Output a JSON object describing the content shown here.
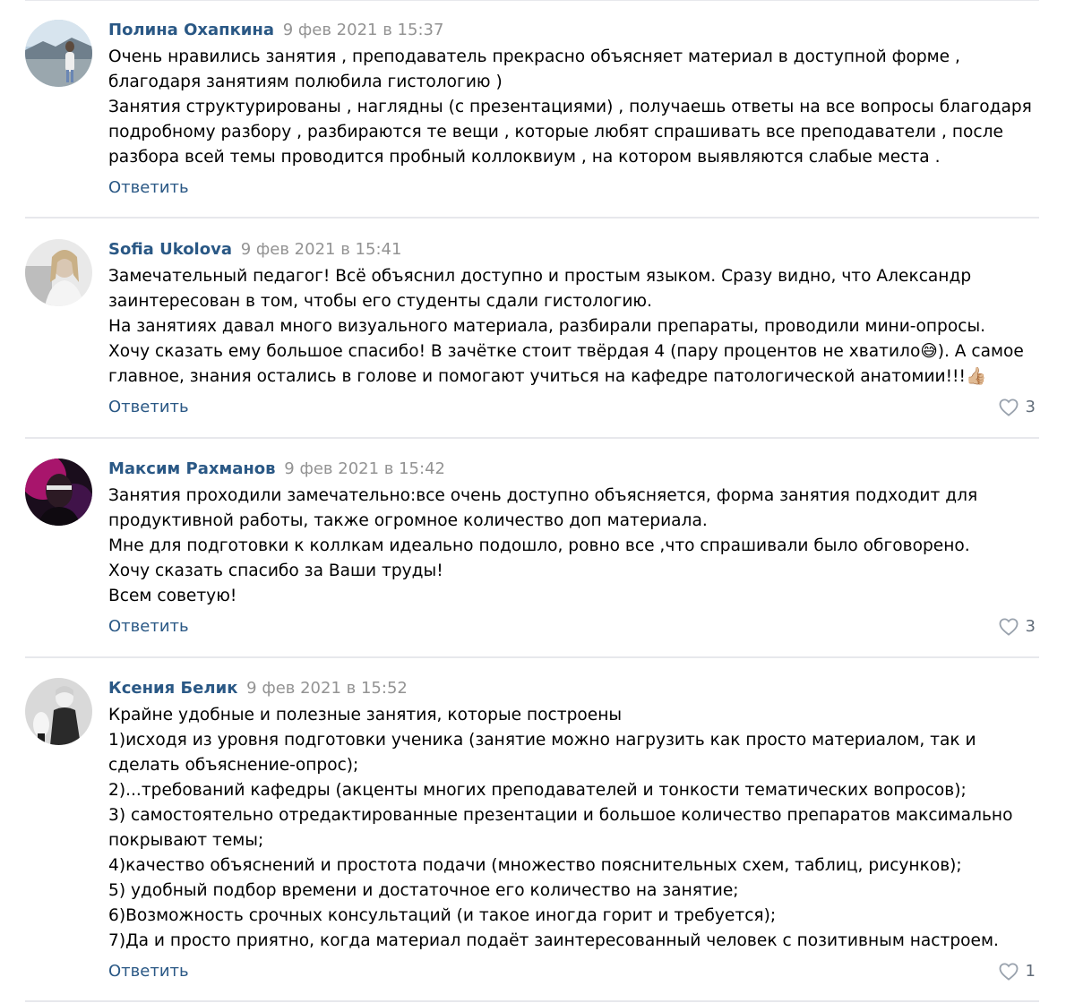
{
  "reply_label": "Ответить",
  "comments": [
    {
      "author": "Полина Охапкина",
      "date": "9 фев 2021 в 15:37",
      "lines": [
        "Очень нравились занятия , преподаватель прекрасно объясняет материал в доступной форме ,",
        "благодаря занятиям полюбила гистологию )",
        "Занятия структурированы , наглядны (с презентациями) , получаешь ответы на все вопросы благодаря",
        "подробному разбору , разбираются те вещи , которые любят спрашивать все преподаватели , после",
        "разбора всей темы проводится пробный коллоквиум , на котором выявляются слабые места ."
      ],
      "likes": null
    },
    {
      "author": "Sofia Ukolova",
      "date": "9 фев 2021 в 15:41",
      "lines": [
        "Замечательный педагог! Всё объяснил доступно и простым языком. Сразу видно, что Александр",
        "заинтересован в том, чтобы его студенты сдали гистологию.",
        "На занятиях давал много визуального материала, разбирали препараты, проводили мини-опросы.",
        "Хочу сказать ему большое спасибо! В зачётке стоит твёрдая 4 (пару процентов не хватило😅). А самое",
        "главное, знания остались в голове и помогают учиться на кафедре патологической анатомии!!!👍🏼"
      ],
      "likes": "3"
    },
    {
      "author": "Максим Рахманов",
      "date": "9 фев 2021 в 15:42",
      "lines": [
        "Занятия проходили замечательно:все очень доступно объясняется, форма занятия подходит для",
        "продуктивной работы, также огромное количество доп материала.",
        "Мне для подготовки к коллкам идеально подошло, ровно все ,что спрашивали было обговорено.",
        "Хочу сказать спасибо за Ваши труды!",
        "Всем советую!"
      ],
      "likes": "3"
    },
    {
      "author": "Ксения Белик",
      "date": "9 фев 2021 в 15:52",
      "lines": [
        "Крайне удобные и полезные занятия, которые построены",
        "1)исходя из уровня подготовки ученика (занятие можно нагрузить как просто материалом, так и",
        "сделать объяснение-опрос);",
        "2)...требований кафедры (акценты многих преподавателей и тонкости тематических вопросов);",
        "3) самостоятельно отредактированные презентации и большое количество препаратов максимально",
        "покрывают темы;",
        "4)качество объяснений и простота подачи (множество пояснительных схем, таблиц, рисунков);",
        "5) удобный подбор времени и достаточное его количество на занятие;",
        "6)Возможность срочных консультаций (и такое иногда горит и требуется);",
        "7)Да и просто приятно, когда материал подаёт заинтересованный человек с позитивным настроем."
      ],
      "likes": "1"
    }
  ],
  "icons": {
    "like": "heart-outline-icon"
  },
  "colors": {
    "author": "#2a5885",
    "date": "#939393",
    "reply": "#2a5885",
    "likes": "#626d7a",
    "separator": "#e7e8ec"
  }
}
